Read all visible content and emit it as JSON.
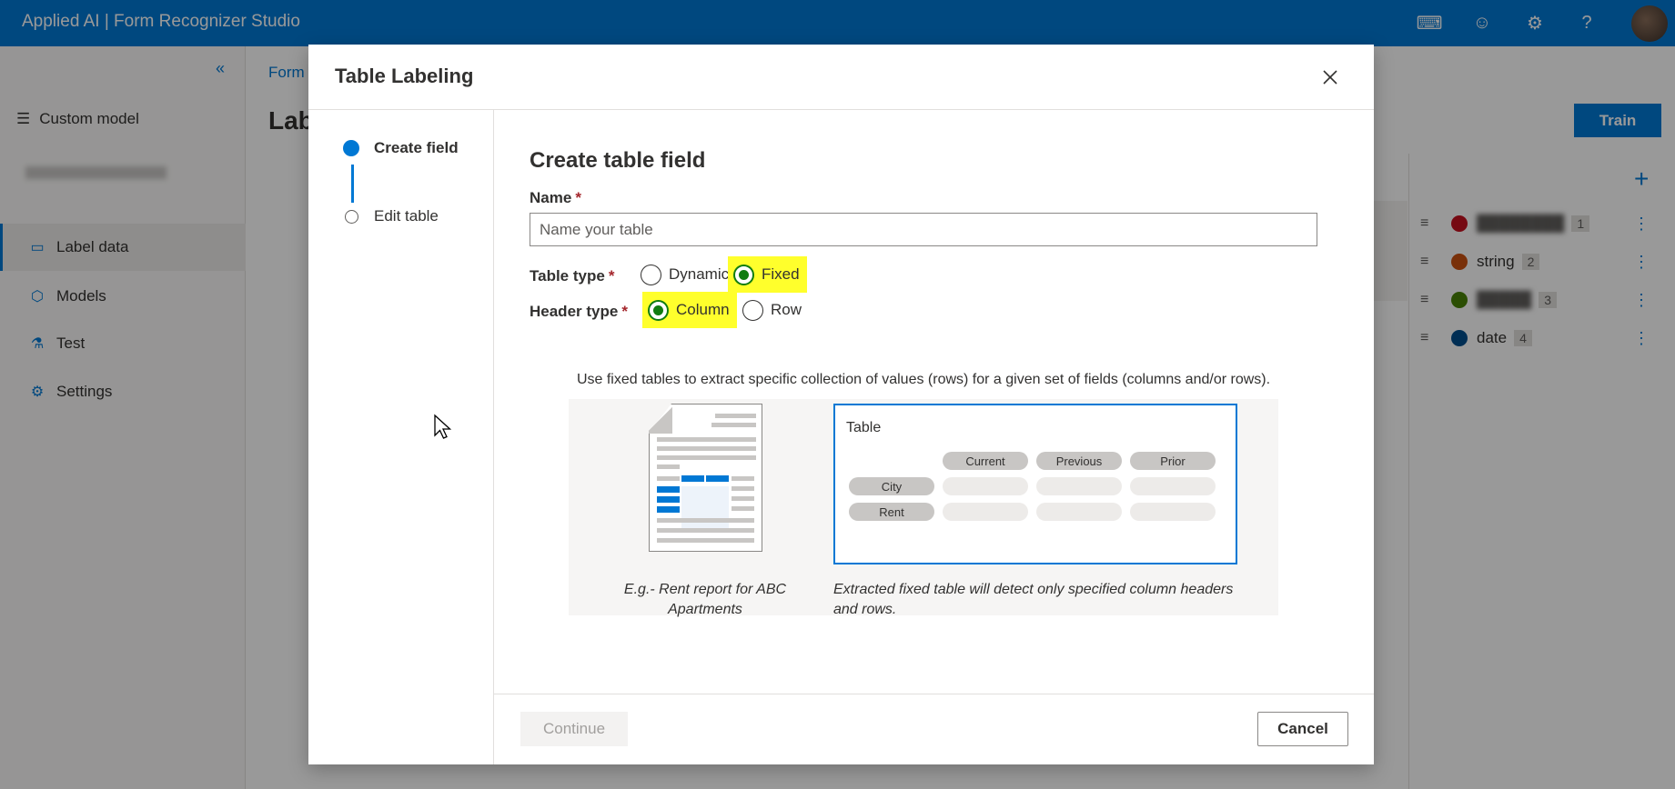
{
  "app": {
    "title": "Applied AI | Form Recognizer Studio"
  },
  "sidebar": {
    "custom_model": "Custom model",
    "items": [
      {
        "label": "Label data",
        "icon": "document-icon",
        "active": true
      },
      {
        "label": "Models",
        "icon": "cube-icon",
        "active": false
      },
      {
        "label": "Test",
        "icon": "flask-icon",
        "active": false
      },
      {
        "label": "Settings",
        "icon": "gear-icon",
        "active": false
      }
    ]
  },
  "main": {
    "breadcrumb": "Form",
    "page_title": "Lab",
    "train_label": "Train",
    "fields": [
      {
        "name": "",
        "color": "#c50f1f",
        "count": "1",
        "blurred": true
      },
      {
        "name": "string",
        "color": "#ca5010",
        "count": "2",
        "blurred": false
      },
      {
        "name": "",
        "color": "#498205",
        "count": "3",
        "blurred": true
      },
      {
        "name": "date",
        "color": "#004e8c",
        "count": "4",
        "blurred": false
      }
    ]
  },
  "modal": {
    "title": "Table Labeling",
    "steps": [
      {
        "label": "Create field",
        "active": true
      },
      {
        "label": "Edit table",
        "active": false
      }
    ],
    "heading": "Create table field",
    "name_label": "Name",
    "name_placeholder": "Name your table",
    "name_value": "",
    "table_type_label": "Table type",
    "table_type_options": [
      {
        "label": "Dynamic",
        "checked": false
      },
      {
        "label": "Fixed",
        "checked": true
      }
    ],
    "header_type_label": "Header type",
    "header_type_options": [
      {
        "label": "Column",
        "checked": true
      },
      {
        "label": "Row",
        "checked": false
      }
    ],
    "description": "Use fixed tables to extract specific collection of values (rows) for a given set of fields (columns and/or rows).",
    "illustration": {
      "doc_caption": "E.g.- Rent report for ABC Apartments",
      "table_title": "Table",
      "columns": [
        "Current",
        "Previous",
        "Prior"
      ],
      "rows": [
        "City",
        "Rent"
      ],
      "table_caption": "Extracted fixed table will detect only specified column headers and rows."
    },
    "continue_label": "Continue",
    "cancel_label": "Cancel"
  },
  "colors": {
    "accent": "#0078d4",
    "highlight": "#ffff2c",
    "radio_checked": "#107c10"
  }
}
